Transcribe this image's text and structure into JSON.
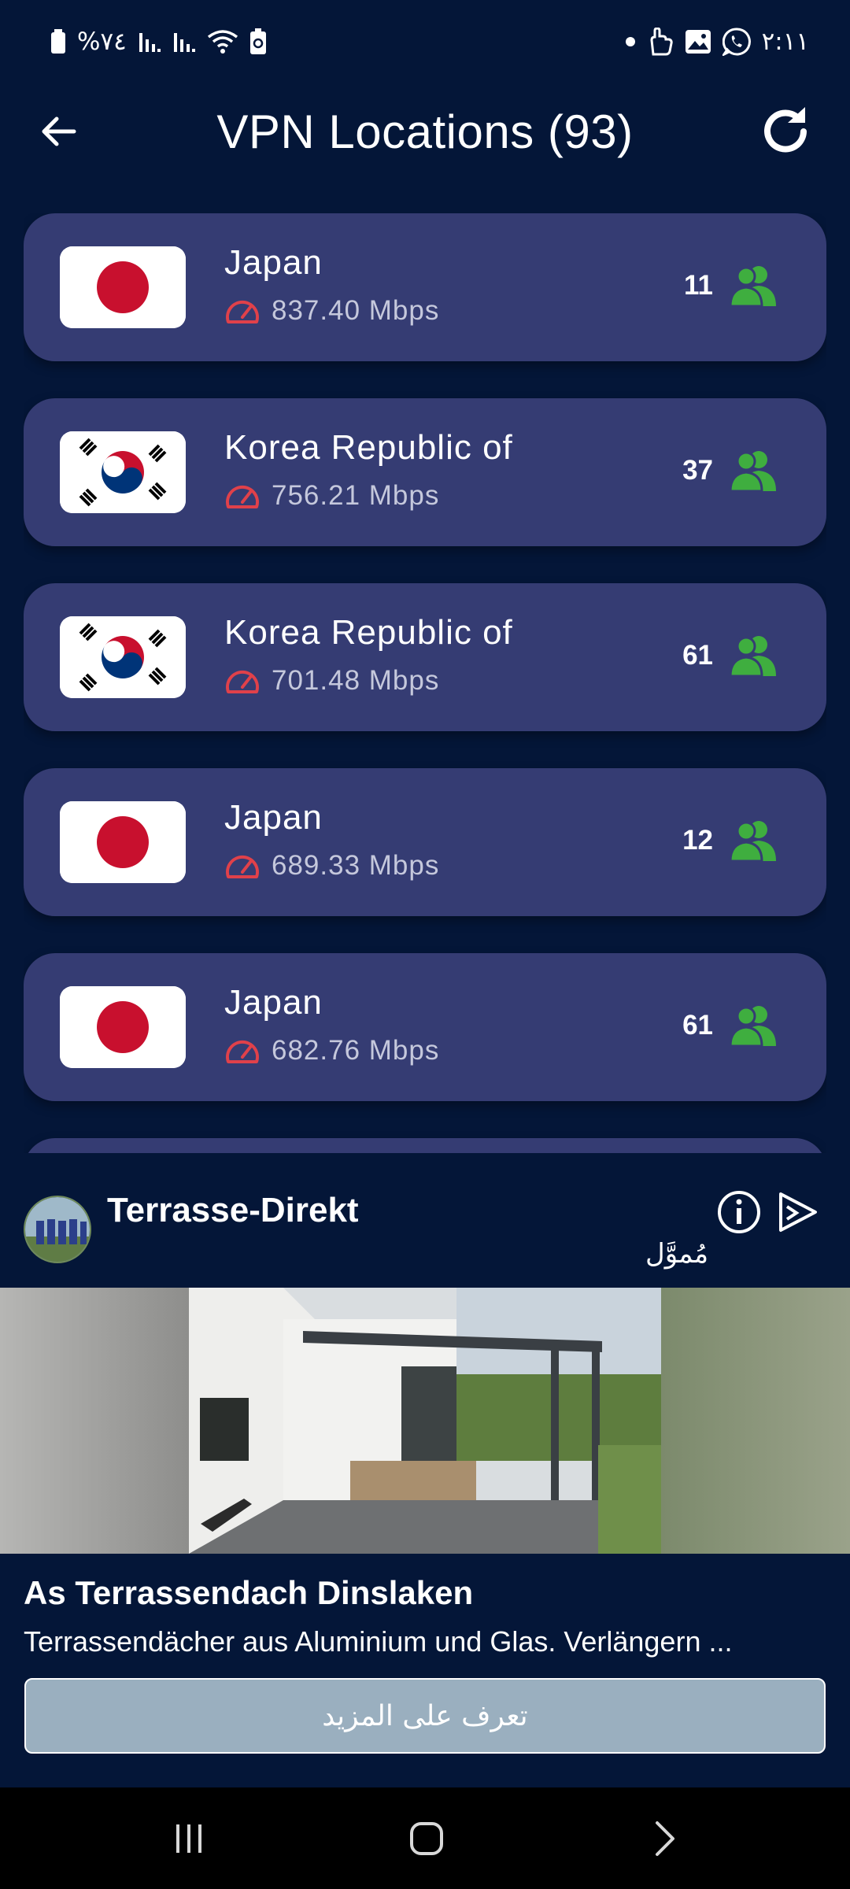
{
  "status_bar": {
    "battery_percent": "%٧٤",
    "time": "٢:١١",
    "left_icons": [
      "battery-icon",
      "signal-icon",
      "signal-icon",
      "wifi-icon",
      "battery-saver-icon"
    ],
    "right_icons": [
      "dot-icon",
      "hand-icon",
      "gallery-icon",
      "whatsapp-icon"
    ]
  },
  "header": {
    "title": "VPN Locations (93)",
    "back_icon": "back-arrow-icon",
    "refresh_icon": "refresh-icon"
  },
  "servers": [
    {
      "country": "Japan",
      "flag": "japan-flag-icon",
      "speed": "837.40 Mbps",
      "users": "11"
    },
    {
      "country": "Korea Republic of",
      "flag": "korea-flag-icon",
      "speed": "756.21 Mbps",
      "users": "37"
    },
    {
      "country": "Korea Republic of",
      "flag": "korea-flag-icon",
      "speed": "701.48 Mbps",
      "users": "61"
    },
    {
      "country": "Japan",
      "flag": "japan-flag-icon",
      "speed": "689.33 Mbps",
      "users": "12"
    },
    {
      "country": "Japan",
      "flag": "japan-flag-icon",
      "speed": "682.76 Mbps",
      "users": "61"
    }
  ],
  "ad": {
    "brand": "Terrasse-Direkt",
    "sponsored": "مُموَّل",
    "headline": "As Terrassendach Dinslaken",
    "body": "Terrassendächer aus Aluminium und Glas. Verlängern ...",
    "cta": "تعرف على المزيد"
  },
  "colors": {
    "background": "#041638",
    "card": "#353c73",
    "speed_icon": "#e0414a",
    "users_icon": "#3fae3f",
    "cta": "#9aafbf"
  }
}
